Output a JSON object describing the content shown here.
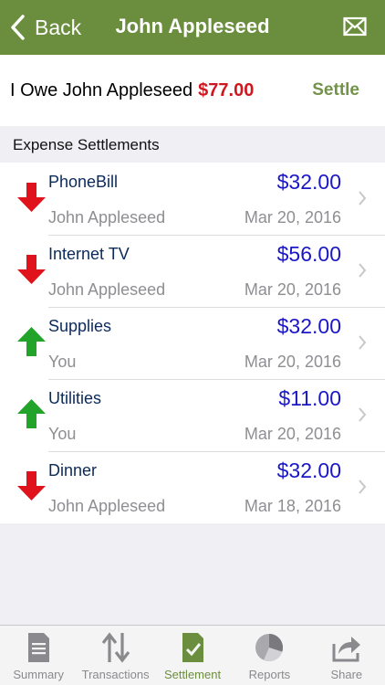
{
  "header": {
    "back_label": "Back",
    "title": "John Appleseed"
  },
  "summary": {
    "owe_text": "I Owe John Appleseed",
    "owe_amount": "$77.00",
    "settle_label": "Settle"
  },
  "section": {
    "title": "Expense Settlements"
  },
  "settlements": [
    {
      "name": "PhoneBill",
      "amount": "$32.00",
      "person": "John Appleseed",
      "date": "Mar 20, 2016",
      "direction": "down"
    },
    {
      "name": "Internet TV",
      "amount": "$56.00",
      "person": "John Appleseed",
      "date": "Mar 20, 2016",
      "direction": "down"
    },
    {
      "name": "Supplies",
      "amount": "$32.00",
      "person": "You",
      "date": "Mar 20, 2016",
      "direction": "up"
    },
    {
      "name": "Utilities",
      "amount": "$11.00",
      "person": "You",
      "date": "Mar 20, 2016",
      "direction": "up"
    },
    {
      "name": "Dinner",
      "amount": "$32.00",
      "person": "John Appleseed",
      "date": "Mar 18, 2016",
      "direction": "down"
    }
  ],
  "tabs": [
    {
      "label": "Summary",
      "icon": "document-icon"
    },
    {
      "label": "Transactions",
      "icon": "up-down-arrows-icon"
    },
    {
      "label": "Settlement",
      "icon": "checked-document-icon",
      "active": true
    },
    {
      "label": "Reports",
      "icon": "pie-chart-icon"
    },
    {
      "label": "Share",
      "icon": "share-icon"
    }
  ],
  "colors": {
    "header_bg": "#6b8e3e",
    "owe_amount": "#d0161f",
    "settle": "#74934a",
    "amount": "#1a17c7",
    "arrow_down": "#e0121b",
    "arrow_up": "#22a32a",
    "tab_active": "#6b8e3e"
  }
}
